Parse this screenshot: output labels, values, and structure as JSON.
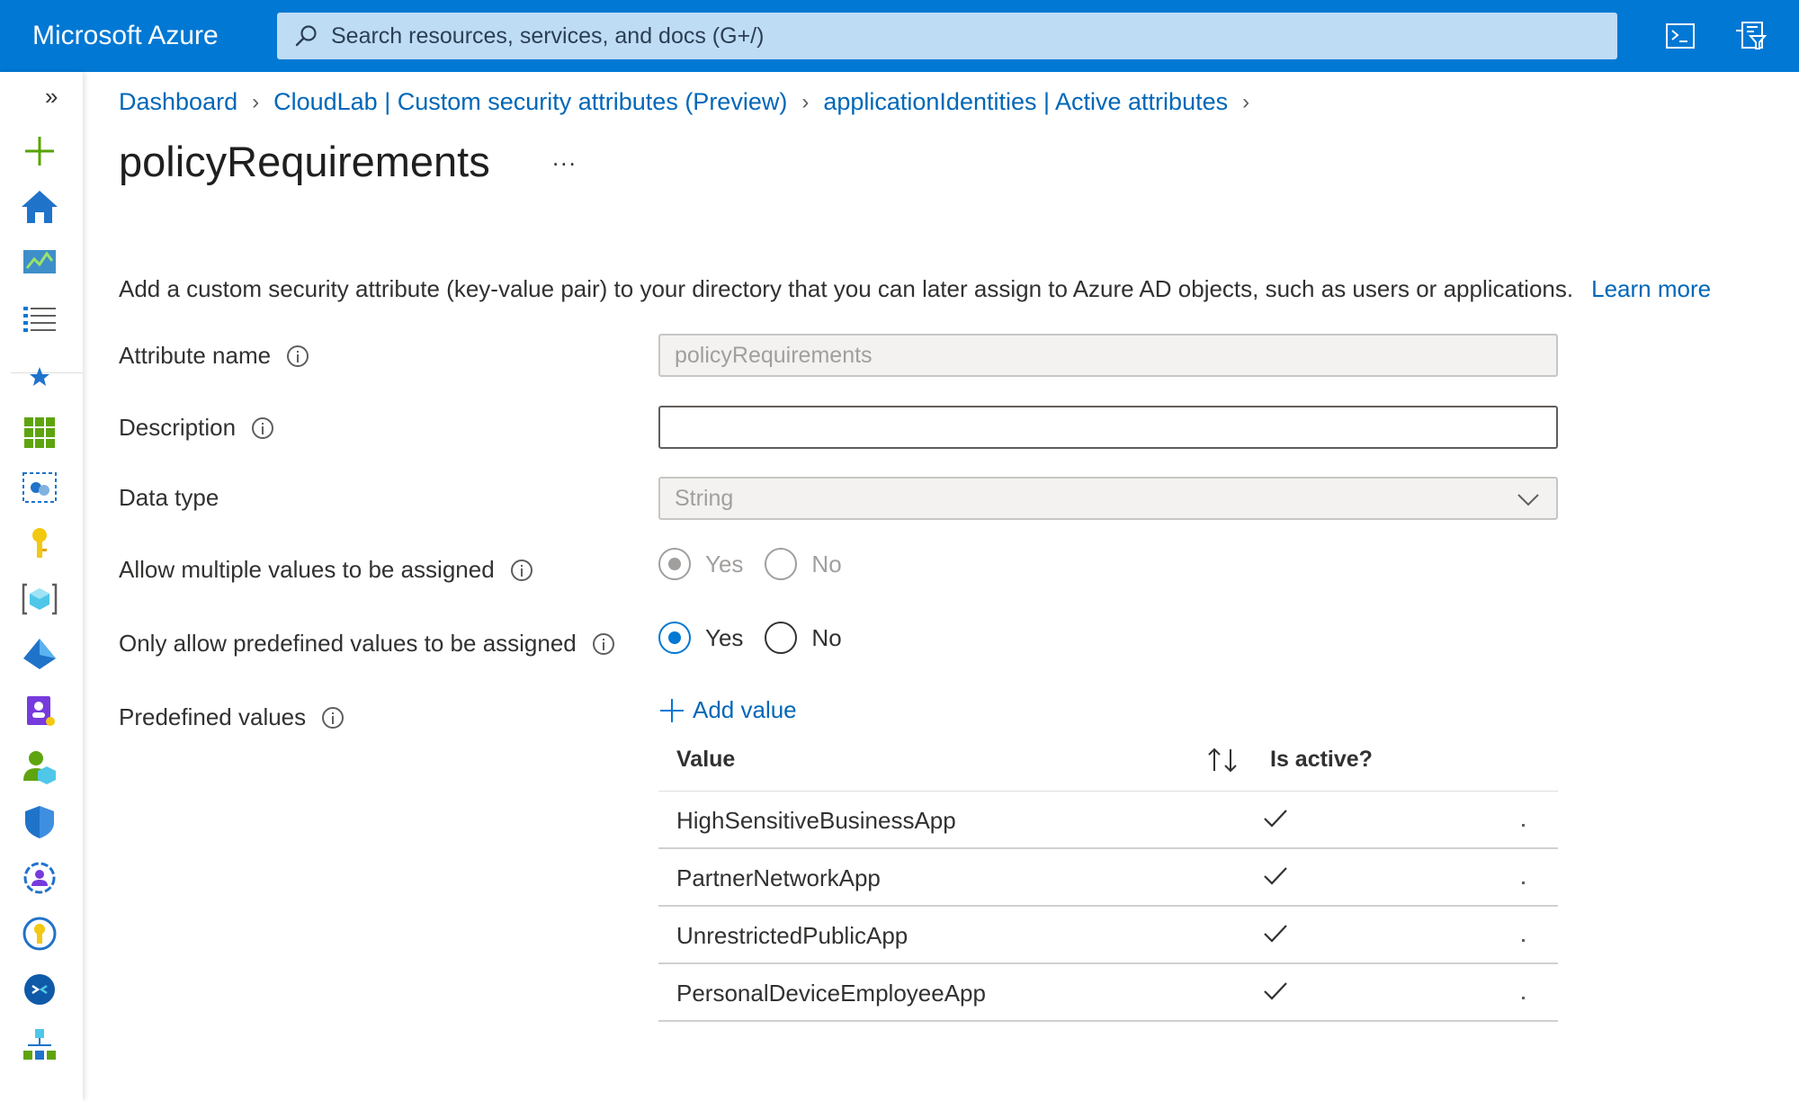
{
  "topbar": {
    "brand": "Microsoft Azure",
    "search_placeholder": "Search resources, services, and docs (G+/)",
    "icons": [
      "cloud-shell-icon",
      "directory-filter-icon"
    ]
  },
  "rail": {
    "expand": "»",
    "icons": [
      "create-resource-icon",
      "home-icon",
      "dashboard-icon",
      "all-services-icon",
      "favorites-icon",
      "all-resources-icon",
      "resource-groups-icon",
      "key-vault-icon",
      "app-services-icon",
      "azure-ad-icon",
      "identity-governance-icon",
      "users-icon",
      "security-icon",
      "groups-icon",
      "key-icon",
      "remote-desktop-icon",
      "hierarchy-icon"
    ]
  },
  "breadcrumb": {
    "items": [
      "Dashboard",
      "CloudLab | Custom security attributes (Preview)",
      "applicationIdentities | Active attributes"
    ]
  },
  "page": {
    "title": "policyRequirements",
    "more": "...",
    "description": "Add a custom security attribute (key-value pair) to your directory that you can later assign to Azure AD objects, such as users or applications.",
    "learn_more": "Learn more"
  },
  "form": {
    "attribute_name": {
      "label": "Attribute name",
      "value": "policyRequirements"
    },
    "description": {
      "label": "Description",
      "value": ""
    },
    "data_type": {
      "label": "Data type",
      "value": "String"
    },
    "allow_multiple": {
      "label": "Allow multiple values to be assigned",
      "yes": "Yes",
      "no": "No",
      "selected": "Yes",
      "disabled": true
    },
    "predefined_only": {
      "label": "Only allow predefined values to be assigned",
      "yes": "Yes",
      "no": "No",
      "selected": "Yes"
    },
    "predefined_values": {
      "label": "Predefined values",
      "add_label": "Add value"
    }
  },
  "table": {
    "headers": {
      "value": "Value",
      "active": "Is active?"
    },
    "rows": [
      {
        "value": "HighSensitiveBusinessApp",
        "active": true
      },
      {
        "value": "PartnerNetworkApp",
        "active": true
      },
      {
        "value": "UnrestrictedPublicApp",
        "active": true
      },
      {
        "value": "PersonalDeviceEmployeeApp",
        "active": true
      }
    ]
  },
  "colors": {
    "accent": "#0078d4",
    "link": "#0067b8",
    "search_bg": "#bfdcf5"
  }
}
